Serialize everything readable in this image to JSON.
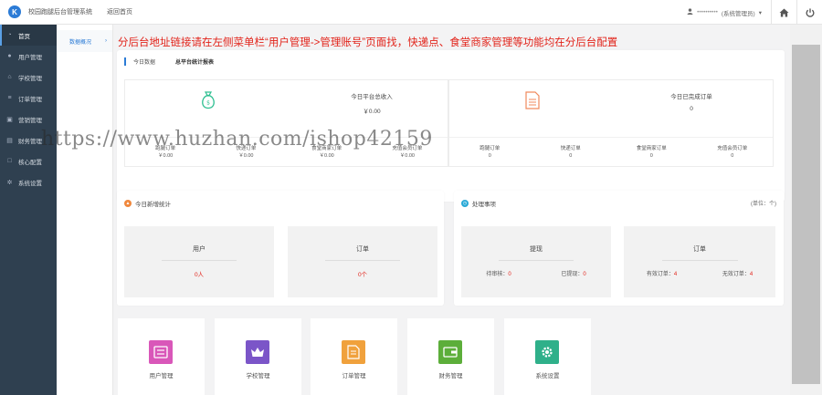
{
  "header": {
    "logo_text": "K",
    "app_title": "校园跑腿后台管理系统",
    "home_link": "返回首页",
    "user_name": "••••••••••",
    "user_role": "(系统管理员)"
  },
  "sidebar": {
    "items": [
      {
        "label": "首页",
        "icon": "speedometer-icon"
      },
      {
        "label": "用户管理",
        "icon": "user-icon"
      },
      {
        "label": "学校管理",
        "icon": "institution-icon"
      },
      {
        "label": "订单管理",
        "icon": "list-icon"
      },
      {
        "label": "营销管理",
        "icon": "gift-icon"
      },
      {
        "label": "财务管理",
        "icon": "money-icon"
      },
      {
        "label": "核心配置",
        "icon": "config-icon"
      },
      {
        "label": "系统设置",
        "icon": "gear-icon"
      }
    ]
  },
  "subnav": {
    "item": "数据概况",
    "chevron": "›"
  },
  "notice": "分后台地址链接请在左侧菜单栏“用户管理->管理账号”页面找，快递点、食堂商家管理等功能均在分后台配置",
  "tabs": {
    "today": "今日数据",
    "total": "总平台统计报表"
  },
  "income": {
    "title": "今日平台总收入",
    "value": "￥0.00",
    "subs": [
      {
        "label": "跑腿订单",
        "value": "￥0.00"
      },
      {
        "label": "快递订单",
        "value": "￥0.00"
      },
      {
        "label": "食堂商家订单",
        "value": "￥0.00"
      },
      {
        "label": "充值会员订单",
        "value": "￥0.00"
      }
    ]
  },
  "orders": {
    "title": "今日已完成订单",
    "value": "0",
    "subs": [
      {
        "label": "跑腿订单",
        "value": "0"
      },
      {
        "label": "快递订单",
        "value": "0"
      },
      {
        "label": "食堂商家订单",
        "value": "0"
      },
      {
        "label": "充值会员订单",
        "value": "0"
      }
    ]
  },
  "watermark": "https://www.huzhan.com/ishop42159",
  "new_today": {
    "title": "今日新增统计",
    "user_title": "用户",
    "user_value": "0人",
    "order_title": "订单",
    "order_value": "0个"
  },
  "pending": {
    "title": "处理事项",
    "unit": "(单位：个)",
    "withdraw_title": "提现",
    "withdraw_pending_label": "待审核：",
    "withdraw_pending_value": "0",
    "withdraw_done_label": "已提现：",
    "withdraw_done_value": "0",
    "order_title": "订单",
    "valid_label": "有效订单：",
    "valid_value": "4",
    "invalid_label": "无效订单：",
    "invalid_value": "4"
  },
  "tiles": [
    {
      "label": "用户管理",
      "icon": "user-card-icon",
      "color": "#d957b9"
    },
    {
      "label": "学校管理",
      "icon": "crown-icon",
      "color": "#7b55c8"
    },
    {
      "label": "订单管理",
      "icon": "document-icon",
      "color": "#f0a13c"
    },
    {
      "label": "财务管理",
      "icon": "wallet-icon",
      "color": "#5cae3a"
    },
    {
      "label": "系统设置",
      "icon": "gear-icon",
      "color": "#2fb08a"
    }
  ],
  "colors": {
    "accent": "#2b7bd6",
    "notice_red": "#e2231a",
    "sidebar": "#2f4050"
  }
}
